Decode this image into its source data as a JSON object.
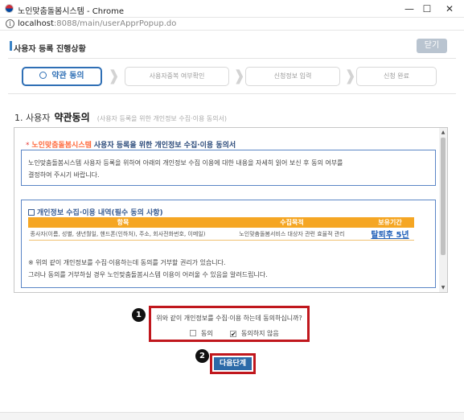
{
  "window": {
    "title": "노인맞춤돌봄시스템 - Chrome",
    "controls": {
      "minimize": "—",
      "maximize": "☐",
      "close": "✕"
    }
  },
  "address_bar": {
    "info_glyph": "i",
    "host": "localhost",
    "path": ":8088/main/userApprPopup.do"
  },
  "header": {
    "title": "사용자 등록 진행상황",
    "close_label": "닫기"
  },
  "steps": [
    {
      "label": "약관 동의",
      "active": true
    },
    {
      "label": "사용자중복 여부확인",
      "active": false
    },
    {
      "label": "신청정보 입력",
      "active": false
    },
    {
      "label": "신청 완료",
      "active": false
    }
  ],
  "step_separator": "❱",
  "section": {
    "number": "1. 사용자",
    "bold": "약관동의",
    "subtitle": "(사용자 등록을 위한 개인정보 수집·이용 동의서)"
  },
  "intro": {
    "star": "*",
    "brand": "노인맞춤돌봄시스템",
    "title_rest": "사용자 등록을 위한 개인정보 수집·이용 동의서",
    "body_line1": "노인맞춤돌봄시스템 사용자 등록을 위하여 아래의 개인정보 수집 이용에 대한 내용을 자세히 읽어 보신 후 동의 여부를",
    "body_line2": "결정하여 주시기 바랍니다."
  },
  "collection": {
    "heading": "개인정보 수집·이용 내역(필수 동의 사항)",
    "columns": [
      "항목",
      "수집목적",
      "보유기간"
    ],
    "row": {
      "items": "종사자(이름, 성별, 생년월일, 핸드폰(인하처), 주소, 회사전화번호, 이메일)",
      "purpose": "노인맞춤돌봄서비스 대상자 관련 효율적 관리",
      "period": "탈퇴후 5년"
    },
    "note_line1": "※ 위의 같이 개인정보를 수집·이용하는데 동의를 거부할 권리가 있습니다.",
    "note_line2": "그러나 동의를 거부하실 경우 노인맞춤돌봄시스템 이용이 어려울 수 있음을 알려드립니다."
  },
  "scrollbar": {
    "up": "▲",
    "down": "▼"
  },
  "consent": {
    "question": "위와 같이 개인정보를 수집·이용 하는데 동의하십니까?",
    "agree_label": "동의",
    "disagree_label": "동의하지 않음",
    "agree_checked": false,
    "disagree_checked": true,
    "check_mark": "✔"
  },
  "next_label": "다음단계",
  "badges": {
    "consent": "1",
    "next": "2"
  },
  "colors": {
    "accent_blue": "#2f6fb5",
    "annotation_red": "#c0171d",
    "table_orange": "#f5a623",
    "brand_orange": "#ff6a3d"
  }
}
